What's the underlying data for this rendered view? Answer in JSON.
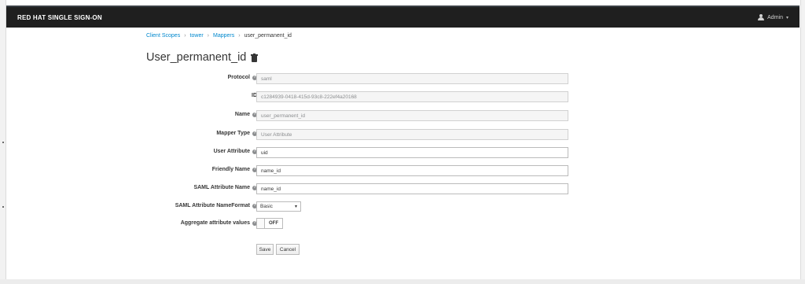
{
  "navbar": {
    "brand": "RED HAT SINGLE SIGN-ON",
    "user_label": "Admin",
    "user_caret": "▾"
  },
  "breadcrumb": {
    "items": [
      "Client Scopes",
      "tower",
      "Mappers"
    ],
    "separator": "›",
    "current": "user_permanent_id"
  },
  "page": {
    "title": "User_permanent_id"
  },
  "form": {
    "help_glyph": "?",
    "protocol": {
      "label": "Protocol",
      "value": "saml"
    },
    "id": {
      "label": "ID",
      "value": "c1284939-0418-415d-93c8-222ef4a20168"
    },
    "name": {
      "label": "Name",
      "value": "user_permanent_id"
    },
    "mapper_type": {
      "label": "Mapper Type",
      "value": "User Attribute"
    },
    "user_attribute": {
      "label": "User Attribute",
      "value": "uid"
    },
    "friendly_name": {
      "label": "Friendly Name",
      "value": "name_id"
    },
    "saml_attribute_name": {
      "label": "SAML Attribute Name",
      "value": "name_id"
    },
    "saml_attribute_nameformat": {
      "label": "SAML Attribute NameFormat",
      "selected": "Basic",
      "caret": "▾"
    },
    "aggregate_attribute_values": {
      "label": "Aggregate attribute values",
      "state": "OFF"
    }
  },
  "buttons": {
    "save": "Save",
    "cancel": "Cancel"
  },
  "colors": {
    "navbar_bg": "#1f1f1f",
    "link": "#0088ce",
    "readonly_bg": "#f5f5f5"
  }
}
